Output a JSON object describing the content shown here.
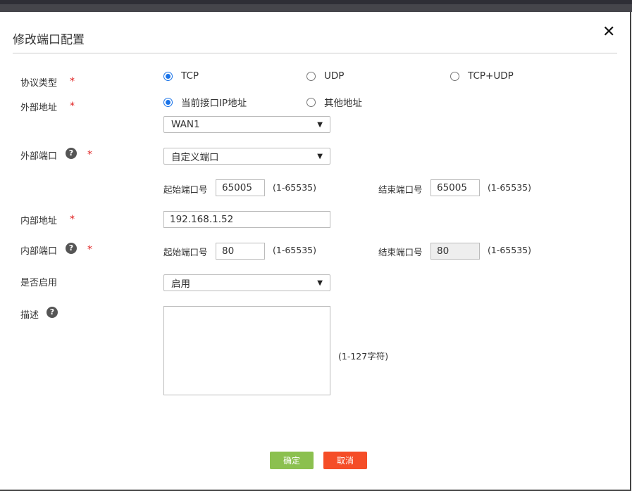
{
  "dialog": {
    "title": "修改端口配置",
    "close": "✕"
  },
  "required_mark": "*",
  "help": "?",
  "protocol": {
    "label": "协议类型",
    "options": [
      "TCP",
      "UDP",
      "TCP+UDP"
    ],
    "selected": "TCP"
  },
  "ext_addr": {
    "label": "外部地址",
    "options": [
      "当前接口IP地址",
      "其他地址"
    ],
    "selected": "当前接口IP地址",
    "interface": "WAN1"
  },
  "ext_port": {
    "label": "外部端口",
    "mode": "自定义端口",
    "start_label": "起始端口号",
    "start": "65005",
    "start_range": "(1-65535)",
    "end_label": "结束端口号",
    "end": "65005",
    "end_range": "(1-65535)"
  },
  "int_addr": {
    "label": "内部地址",
    "value": "192.168.1.52"
  },
  "int_port": {
    "label": "内部端口",
    "start_label": "起始端口号",
    "start": "80",
    "start_range": "(1-65535)",
    "end_label": "结束端口号",
    "end": "80",
    "end_range": "(1-65535)"
  },
  "enable": {
    "label": "是否启用",
    "value": "启用"
  },
  "desc": {
    "label": "描述",
    "value": "",
    "hint": "(1-127字符)"
  },
  "buttons": {
    "ok": "确定",
    "cancel": "取消",
    "ok_color": "#8bc04f",
    "cancel_color": "#f54d27"
  }
}
